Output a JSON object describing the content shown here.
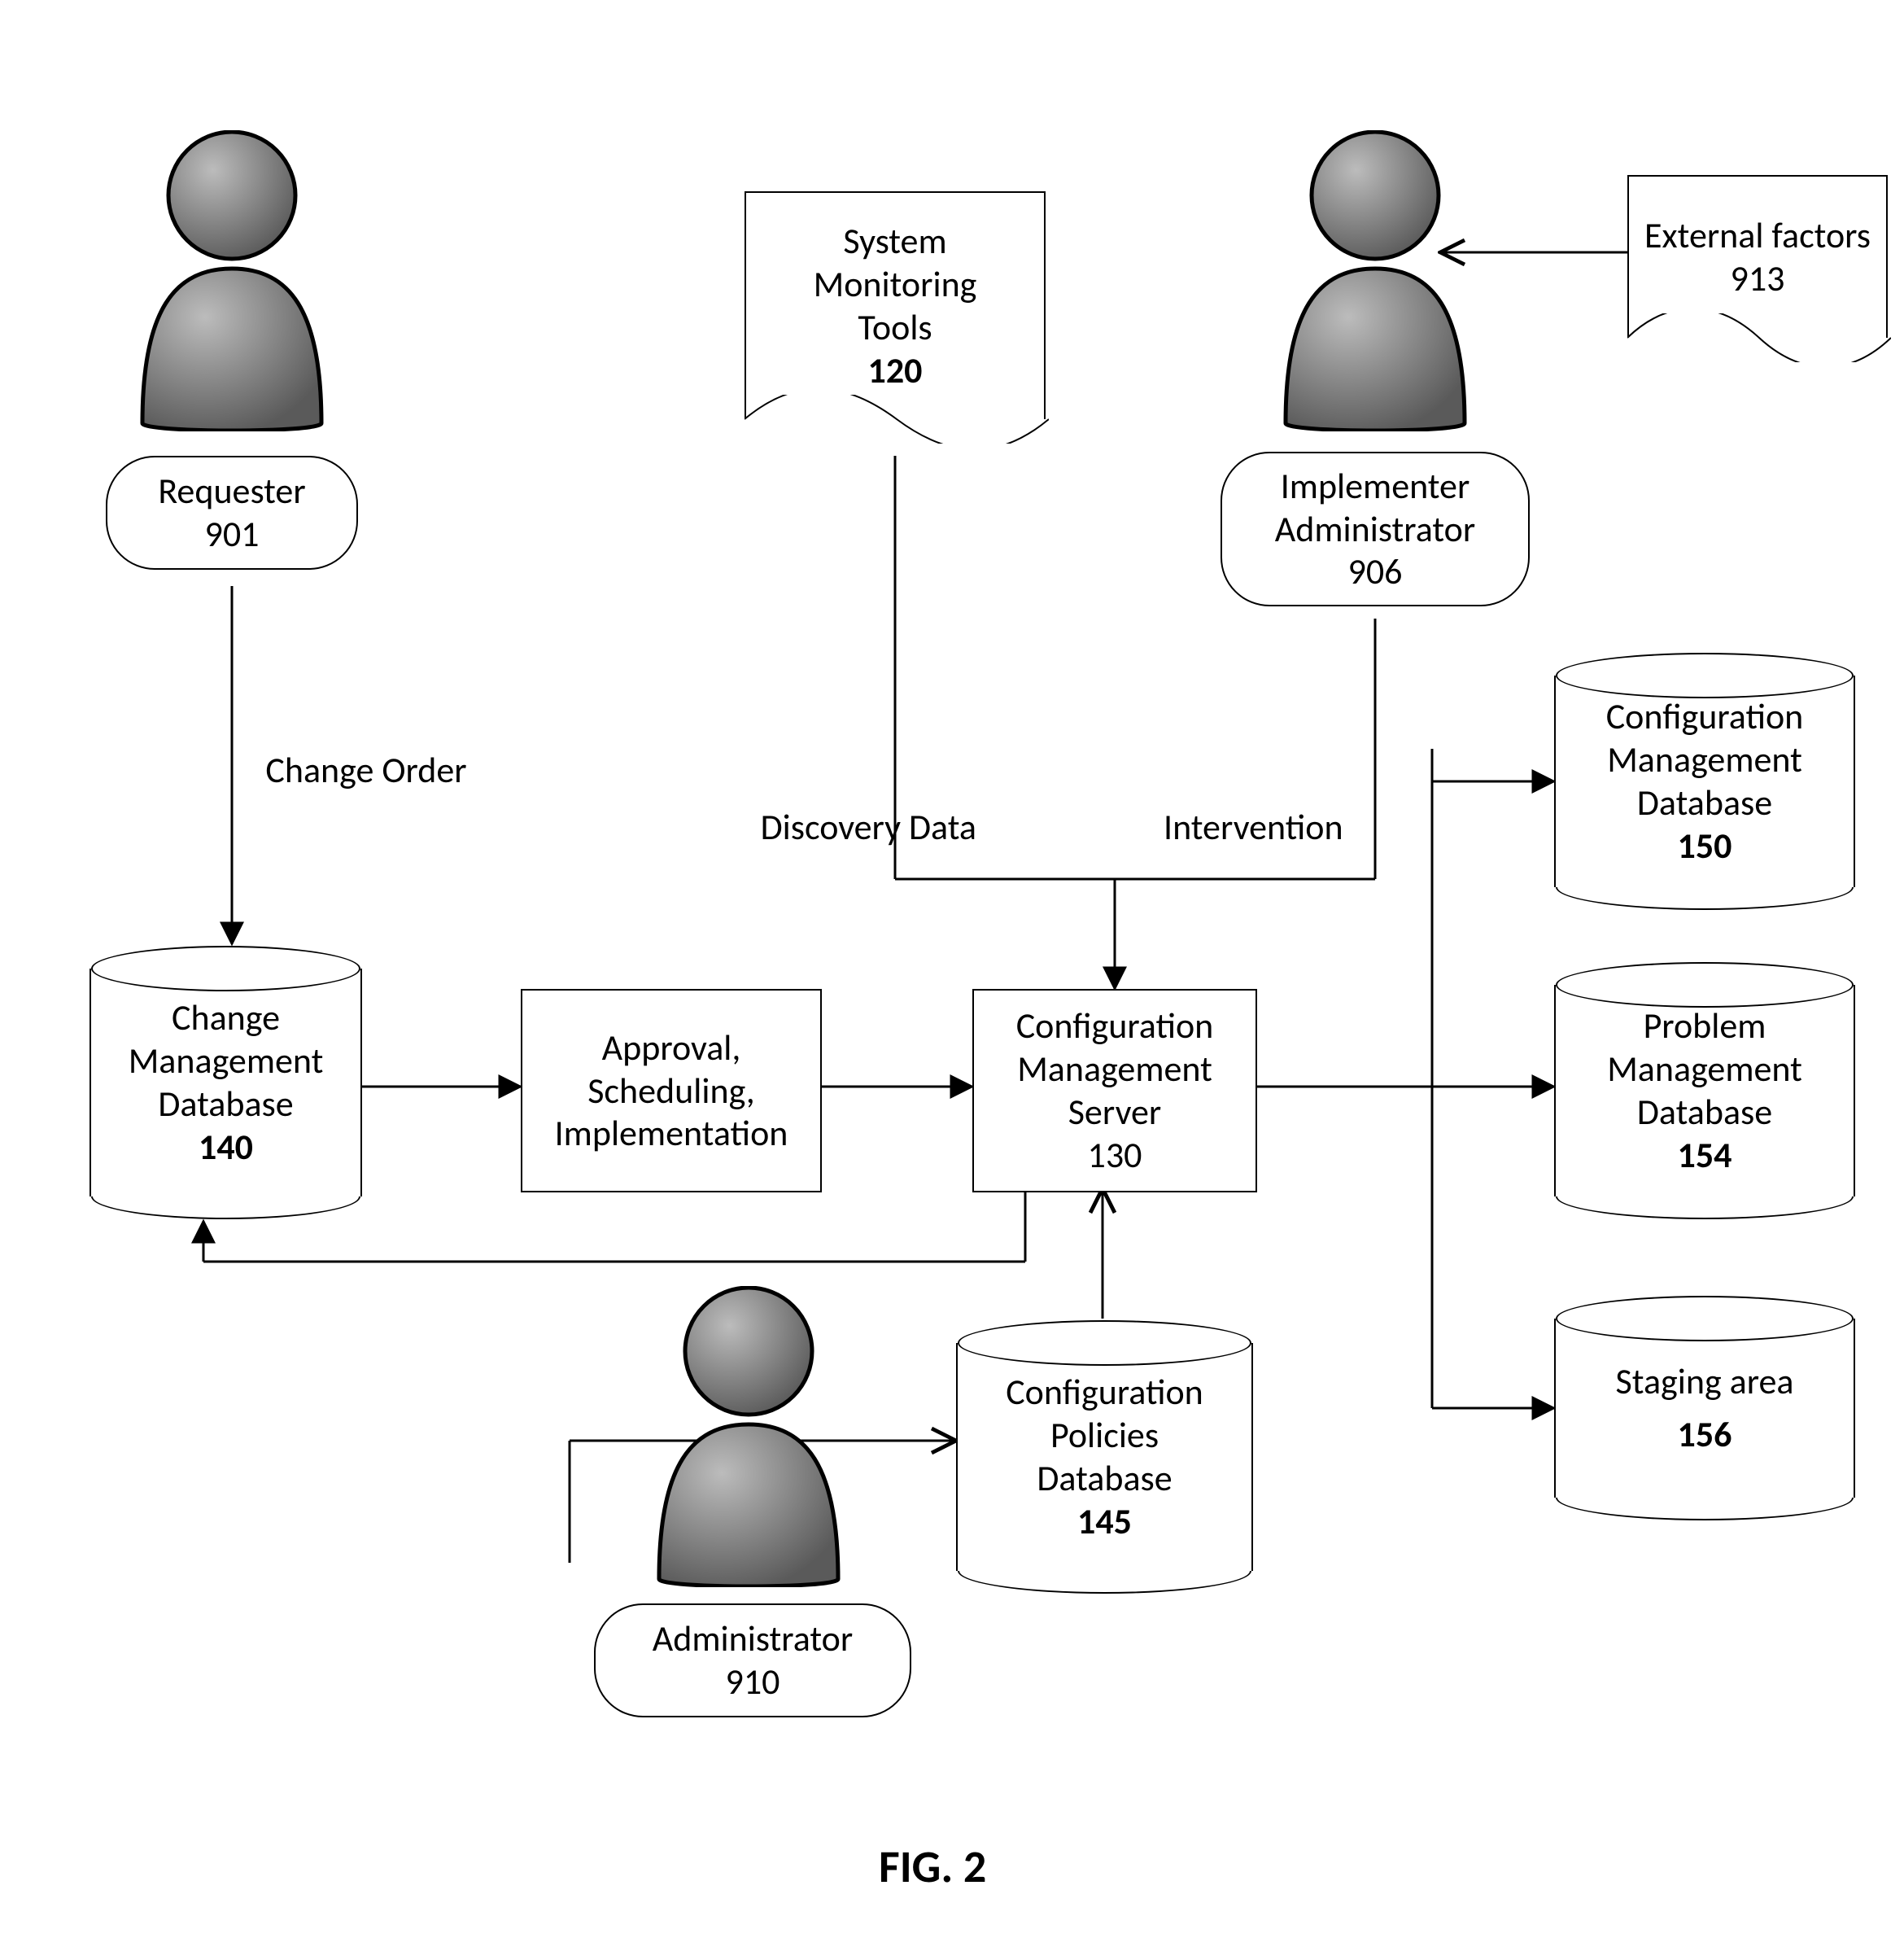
{
  "figure_label": "FIG. 2",
  "actors": {
    "requester": {
      "label": "Requester",
      "ref": "901"
    },
    "implementer": {
      "label1": "Implementer",
      "label2": "Administrator",
      "ref": "906"
    },
    "administrator": {
      "label": "Administrator",
      "ref": "910"
    }
  },
  "docs": {
    "smt": {
      "l1": "System",
      "l2": "Monitoring",
      "l3": "Tools",
      "ref": "120"
    },
    "external": {
      "l1": "External factors",
      "ref": "913"
    }
  },
  "cylinders": {
    "cmdb_change": {
      "l1": "Change",
      "l2": "Management",
      "l3": "Database",
      "ref": "140"
    },
    "policies": {
      "l1": "Configuration",
      "l2": "Policies",
      "l3": "Database",
      "ref": "145"
    },
    "cmdb_config": {
      "l1": "Configuration",
      "l2": "Management",
      "l3": "Database",
      "ref": "150"
    },
    "problem": {
      "l1": "Problem",
      "l2": "Management",
      "l3": "Database",
      "ref": "154"
    },
    "staging": {
      "l1": "Staging area",
      "ref": "156"
    }
  },
  "rects": {
    "approval": {
      "l1": "Approval,",
      "l2": "Scheduling,",
      "l3": "Implementation"
    },
    "cms": {
      "l1": "Configuration",
      "l2": "Management",
      "l3": "Server",
      "ref": "130"
    }
  },
  "edge_labels": {
    "change_order": "Change Order",
    "discovery": "Discovery Data",
    "intervention": "Intervention"
  }
}
